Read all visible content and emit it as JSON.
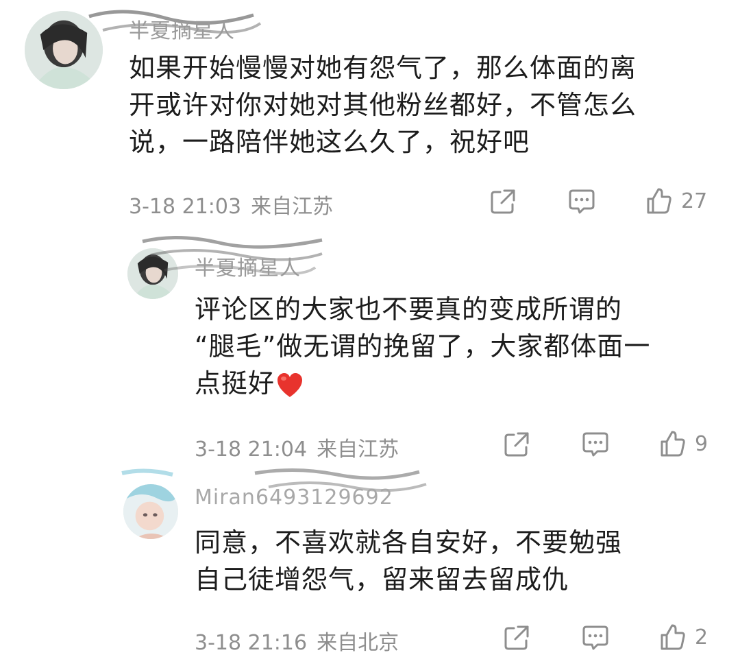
{
  "comments": [
    {
      "username": "半夏摘星人",
      "lines": [
        "如果开始慢慢对她有怨气了，那么体面的离",
        "开或许对你对她对其他粉丝都好，不管怎么",
        "说，一路陪伴她这么久了，祝好吧"
      ],
      "time": "3-18 21:03",
      "location": "来自江苏",
      "likes": "27"
    },
    {
      "username": "半夏摘星人",
      "lines": [
        "评论区的大家也不要真的变成所谓的",
        "“腿毛”做无谓的挽留了，大家都体面一",
        "点挺好"
      ],
      "time": "3-18 21:04",
      "location": "来自江苏",
      "likes": "9"
    },
    {
      "username": "Miran6493129692",
      "lines": [
        "同意，不喜欢就各自安好，不要勉强",
        "自己徒增怨气，留来留去留成仇"
      ],
      "time": "3-18 21:16",
      "location": "来自北京",
      "likes": "2"
    }
  ],
  "icons": {
    "share": "share-icon",
    "comment": "comment-icon",
    "like": "thumbs-up-icon",
    "heart": "red-heart-emoji"
  },
  "colors": {
    "text": "#1c1c1c",
    "meta": "#8e8e8e",
    "heart": "#e8332d"
  }
}
